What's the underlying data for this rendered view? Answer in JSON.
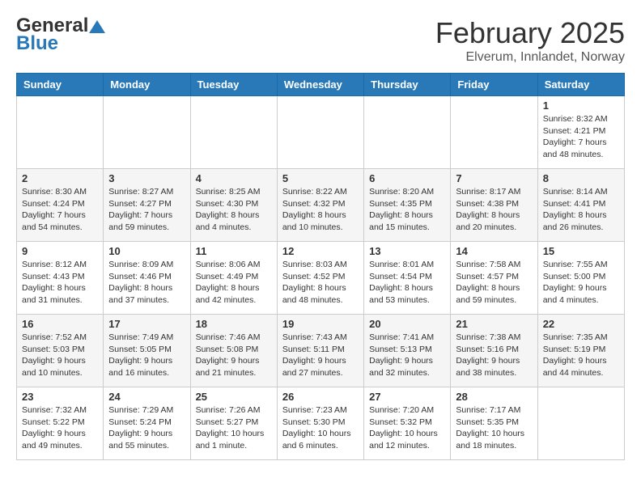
{
  "header": {
    "logo_general": "General",
    "logo_blue": "Blue",
    "month": "February 2025",
    "location": "Elverum, Innlandet, Norway"
  },
  "weekdays": [
    "Sunday",
    "Monday",
    "Tuesday",
    "Wednesday",
    "Thursday",
    "Friday",
    "Saturday"
  ],
  "weeks": [
    [
      {
        "day": "",
        "info": ""
      },
      {
        "day": "",
        "info": ""
      },
      {
        "day": "",
        "info": ""
      },
      {
        "day": "",
        "info": ""
      },
      {
        "day": "",
        "info": ""
      },
      {
        "day": "",
        "info": ""
      },
      {
        "day": "1",
        "info": "Sunrise: 8:32 AM\nSunset: 4:21 PM\nDaylight: 7 hours and 48 minutes."
      }
    ],
    [
      {
        "day": "2",
        "info": "Sunrise: 8:30 AM\nSunset: 4:24 PM\nDaylight: 7 hours and 54 minutes."
      },
      {
        "day": "3",
        "info": "Sunrise: 8:27 AM\nSunset: 4:27 PM\nDaylight: 7 hours and 59 minutes."
      },
      {
        "day": "4",
        "info": "Sunrise: 8:25 AM\nSunset: 4:30 PM\nDaylight: 8 hours and 4 minutes."
      },
      {
        "day": "5",
        "info": "Sunrise: 8:22 AM\nSunset: 4:32 PM\nDaylight: 8 hours and 10 minutes."
      },
      {
        "day": "6",
        "info": "Sunrise: 8:20 AM\nSunset: 4:35 PM\nDaylight: 8 hours and 15 minutes."
      },
      {
        "day": "7",
        "info": "Sunrise: 8:17 AM\nSunset: 4:38 PM\nDaylight: 8 hours and 20 minutes."
      },
      {
        "day": "8",
        "info": "Sunrise: 8:14 AM\nSunset: 4:41 PM\nDaylight: 8 hours and 26 minutes."
      }
    ],
    [
      {
        "day": "9",
        "info": "Sunrise: 8:12 AM\nSunset: 4:43 PM\nDaylight: 8 hours and 31 minutes."
      },
      {
        "day": "10",
        "info": "Sunrise: 8:09 AM\nSunset: 4:46 PM\nDaylight: 8 hours and 37 minutes."
      },
      {
        "day": "11",
        "info": "Sunrise: 8:06 AM\nSunset: 4:49 PM\nDaylight: 8 hours and 42 minutes."
      },
      {
        "day": "12",
        "info": "Sunrise: 8:03 AM\nSunset: 4:52 PM\nDaylight: 8 hours and 48 minutes."
      },
      {
        "day": "13",
        "info": "Sunrise: 8:01 AM\nSunset: 4:54 PM\nDaylight: 8 hours and 53 minutes."
      },
      {
        "day": "14",
        "info": "Sunrise: 7:58 AM\nSunset: 4:57 PM\nDaylight: 8 hours and 59 minutes."
      },
      {
        "day": "15",
        "info": "Sunrise: 7:55 AM\nSunset: 5:00 PM\nDaylight: 9 hours and 4 minutes."
      }
    ],
    [
      {
        "day": "16",
        "info": "Sunrise: 7:52 AM\nSunset: 5:03 PM\nDaylight: 9 hours and 10 minutes."
      },
      {
        "day": "17",
        "info": "Sunrise: 7:49 AM\nSunset: 5:05 PM\nDaylight: 9 hours and 16 minutes."
      },
      {
        "day": "18",
        "info": "Sunrise: 7:46 AM\nSunset: 5:08 PM\nDaylight: 9 hours and 21 minutes."
      },
      {
        "day": "19",
        "info": "Sunrise: 7:43 AM\nSunset: 5:11 PM\nDaylight: 9 hours and 27 minutes."
      },
      {
        "day": "20",
        "info": "Sunrise: 7:41 AM\nSunset: 5:13 PM\nDaylight: 9 hours and 32 minutes."
      },
      {
        "day": "21",
        "info": "Sunrise: 7:38 AM\nSunset: 5:16 PM\nDaylight: 9 hours and 38 minutes."
      },
      {
        "day": "22",
        "info": "Sunrise: 7:35 AM\nSunset: 5:19 PM\nDaylight: 9 hours and 44 minutes."
      }
    ],
    [
      {
        "day": "23",
        "info": "Sunrise: 7:32 AM\nSunset: 5:22 PM\nDaylight: 9 hours and 49 minutes."
      },
      {
        "day": "24",
        "info": "Sunrise: 7:29 AM\nSunset: 5:24 PM\nDaylight: 9 hours and 55 minutes."
      },
      {
        "day": "25",
        "info": "Sunrise: 7:26 AM\nSunset: 5:27 PM\nDaylight: 10 hours and 1 minute."
      },
      {
        "day": "26",
        "info": "Sunrise: 7:23 AM\nSunset: 5:30 PM\nDaylight: 10 hours and 6 minutes."
      },
      {
        "day": "27",
        "info": "Sunrise: 7:20 AM\nSunset: 5:32 PM\nDaylight: 10 hours and 12 minutes."
      },
      {
        "day": "28",
        "info": "Sunrise: 7:17 AM\nSunset: 5:35 PM\nDaylight: 10 hours and 18 minutes."
      },
      {
        "day": "",
        "info": ""
      }
    ]
  ]
}
